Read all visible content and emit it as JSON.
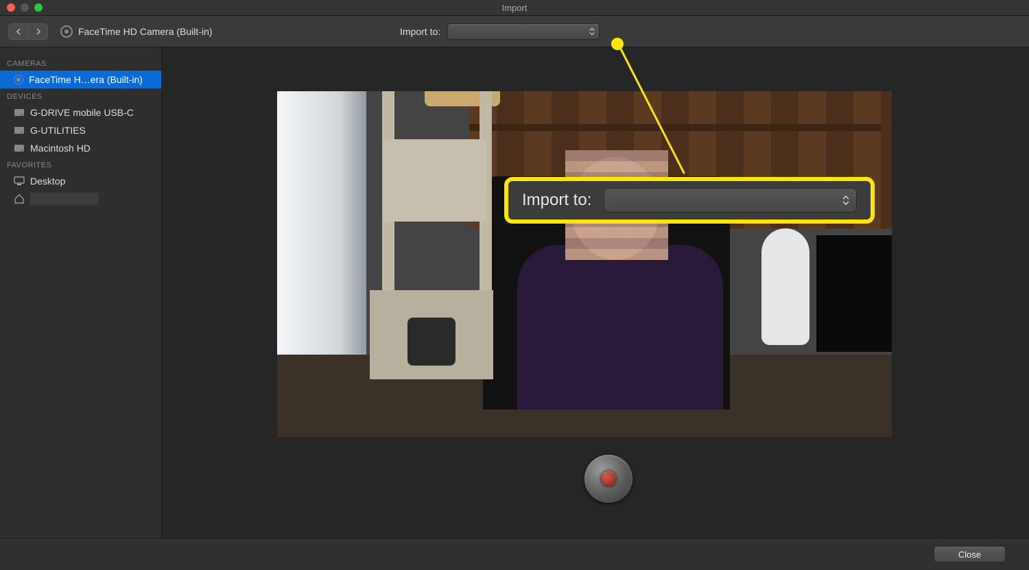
{
  "window": {
    "title": "Import"
  },
  "toolbar": {
    "camera_title": "FaceTime HD Camera (Built-in)",
    "import_to_label": "Import to:",
    "import_to_value": ""
  },
  "sidebar": {
    "sections": [
      {
        "title": "CAMERAS",
        "items": [
          {
            "label": "FaceTime H…era (Built-in)",
            "icon": "camera-ring-icon",
            "selected": true
          }
        ]
      },
      {
        "title": "DEVICES",
        "items": [
          {
            "label": "G-DRIVE mobile USB-C",
            "icon": "hdd-icon"
          },
          {
            "label": "G-UTILITIES",
            "icon": "hdd-icon"
          },
          {
            "label": "Macintosh HD",
            "icon": "hdd-icon"
          }
        ]
      },
      {
        "title": "FAVORITES",
        "items": [
          {
            "label": "Desktop",
            "icon": "desktop-icon"
          },
          {
            "label": "",
            "icon": "home-icon",
            "blurred": true
          }
        ]
      }
    ]
  },
  "callout": {
    "label": "Import to:",
    "value": ""
  },
  "footer": {
    "close_label": "Close"
  },
  "icons": {
    "chevron_left": "chevron-left-icon",
    "chevron_right": "chevron-right-icon",
    "updown": "updown-arrows-icon"
  }
}
